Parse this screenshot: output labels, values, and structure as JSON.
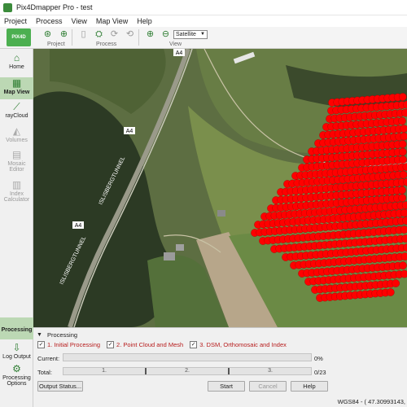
{
  "window": {
    "title": "Pix4Dmapper Pro - test"
  },
  "menu": {
    "items": [
      "Project",
      "Process",
      "View",
      "Map View",
      "Help"
    ]
  },
  "toolbar": {
    "logo_text": "PIX4D",
    "groups": {
      "project": "Project",
      "process": "Process",
      "view": "View"
    },
    "basemap_select": {
      "value": "Satellite"
    }
  },
  "sidebar": {
    "items": [
      {
        "label": "Home",
        "icon": "home-icon",
        "state": "normal"
      },
      {
        "label": "Map View",
        "icon": "map-icon",
        "state": "active"
      },
      {
        "label": "rayCloud",
        "icon": "raycloud-icon",
        "state": "normal"
      },
      {
        "label": "Volumes",
        "icon": "volumes-icon",
        "state": "disabled"
      },
      {
        "label": "Mosaic Editor",
        "icon": "mosaic-icon",
        "state": "disabled"
      },
      {
        "label": "Index Calculator",
        "icon": "index-icon",
        "state": "disabled"
      },
      {
        "label": "Processing",
        "icon": "processing-icon",
        "state": "active"
      },
      {
        "label": "Log Output",
        "icon": "log-icon",
        "state": "normal"
      },
      {
        "label": "Processing Options",
        "icon": "gear-icon",
        "state": "normal"
      }
    ]
  },
  "map": {
    "road_labels": [
      "A4",
      "A4",
      "A4"
    ],
    "tunnel_labels": [
      "ISLISBERGTUNNEL",
      "ISLISBERGTUNNEL"
    ],
    "image_marker_color": "#ff0000"
  },
  "processing": {
    "header": "Processing",
    "steps": [
      {
        "label": "1. Initial Processing",
        "checked": true
      },
      {
        "label": "2. Point Cloud and Mesh",
        "checked": true
      },
      {
        "label": "3. DSM, Orthomosaic and Index",
        "checked": true
      }
    ],
    "current": {
      "label": "Current:",
      "value": "0%"
    },
    "total": {
      "label": "Total:",
      "segments": [
        "1.",
        "2.",
        "3."
      ],
      "value": "0/23"
    },
    "buttons": {
      "output_status": "Output Status...",
      "start": "Start",
      "cancel": "Cancel",
      "help": "Help"
    }
  },
  "status": {
    "coordinates": "WGS84 - ( 47.30993143,"
  }
}
